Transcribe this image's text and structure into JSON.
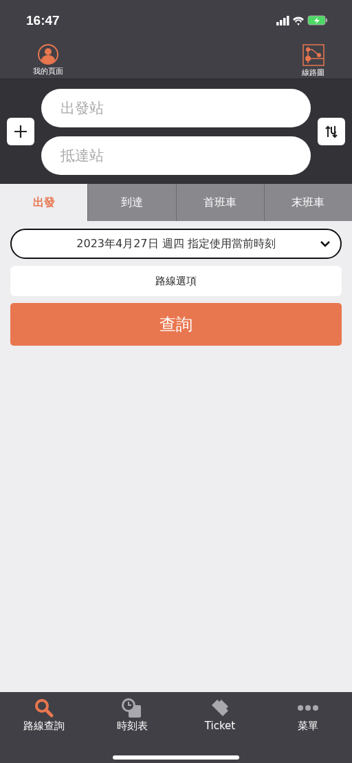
{
  "status_bar": {
    "time": "16:47"
  },
  "header": {
    "left": {
      "label": "我的頁面"
    },
    "right": {
      "label": "線路圖"
    }
  },
  "search": {
    "from": {
      "placeholder": "出發站"
    },
    "to": {
      "placeholder": "抵達站"
    }
  },
  "tabs": [
    {
      "label": "出發",
      "selected": true
    },
    {
      "label": "到達",
      "selected": false
    },
    {
      "label": "首班車",
      "selected": false
    },
    {
      "label": "末班車",
      "selected": false
    }
  ],
  "date_select": {
    "value": "2023年4月27日 週四 指定使用當前時刻"
  },
  "route_options": {
    "label": "路線選項"
  },
  "submit": {
    "label": "查詢"
  },
  "bottom_nav": [
    {
      "label": "路線查詢",
      "selected": true
    },
    {
      "label": "時刻表",
      "selected": false
    },
    {
      "label": "Ticket",
      "selected": false
    },
    {
      "label": "菜單",
      "selected": false
    }
  ]
}
